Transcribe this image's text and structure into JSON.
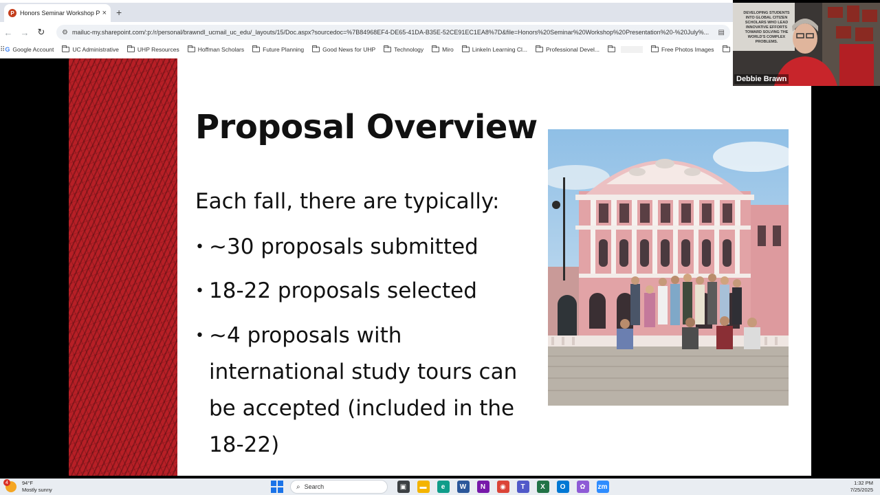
{
  "browser": {
    "tab_title": "Honors Seminar Workshop Pre",
    "tab_close": "×",
    "new_tab": "+",
    "url": "mailuc-my.sharepoint.com/:p:/r/personal/brawndl_ucmail_uc_edu/_layouts/15/Doc.aspx?sourcedoc=%7B84968EF4-DE65-41DA-B35E-52CE91EC1EA8%7D&file=Honors%20Seminar%20Workshop%20Presentation%20-%20July%...",
    "bookmarks": [
      "Google Account",
      "UC Administrative",
      "UHP Resources",
      "Hoffman Scholars",
      "Future Planning",
      "Good News for UHP",
      "Technology",
      "Miro",
      "LinkeIn Learning Cl...",
      "Professional Devel...",
      "",
      "Free Photos Images",
      ""
    ]
  },
  "slide": {
    "title": "Proposal Overview",
    "intro": "Each fall, there are typically:",
    "bullets": [
      "~30 proposals submitted",
      "18-22 proposals selected",
      "~4 proposals with international study tours can be accepted (included in the 18-22)"
    ],
    "bullet_glyph": "•"
  },
  "webcam": {
    "participant_name": "Debbie Brawn",
    "wall_text": "DEVELOPING STUDENTS INTO GLOBAL CITIZEN SCHOLARS WHO LEAD INNOVATIVE EFFORTS TOWARD SOLVING THE WORLD'S COMPLEX PROBLEMS."
  },
  "taskbar": {
    "weather_badge": "4",
    "temperature": "94°F",
    "condition": "Mostly sunny",
    "search_label": "Search",
    "time": "1:32 PM",
    "date": "7/25/2025",
    "apps": [
      {
        "name": "task-view-icon",
        "glyph": "▣",
        "color": "#3c4043"
      },
      {
        "name": "file-explorer-icon",
        "glyph": "▬",
        "color": "#f4b400"
      },
      {
        "name": "edge-icon",
        "glyph": "e",
        "color": "#0f9d8a"
      },
      {
        "name": "word-icon",
        "glyph": "W",
        "color": "#2b579a"
      },
      {
        "name": "onenote-icon",
        "glyph": "N",
        "color": "#7719aa"
      },
      {
        "name": "chrome-icon",
        "glyph": "◉",
        "color": "#db4437"
      },
      {
        "name": "teams-icon",
        "glyph": "T",
        "color": "#5059c9"
      },
      {
        "name": "excel-icon",
        "glyph": "X",
        "color": "#217346"
      },
      {
        "name": "outlook-icon",
        "glyph": "O",
        "color": "#0078d4"
      },
      {
        "name": "copilot-icon",
        "glyph": "✿",
        "color": "#8e5bd6"
      },
      {
        "name": "zoom-icon",
        "glyph": "zm",
        "color": "#2d8cff"
      }
    ]
  },
  "colors": {
    "slide_band": "#b71f26",
    "building_pink": "#e2a3a6",
    "sky": "#b9d6ee"
  }
}
